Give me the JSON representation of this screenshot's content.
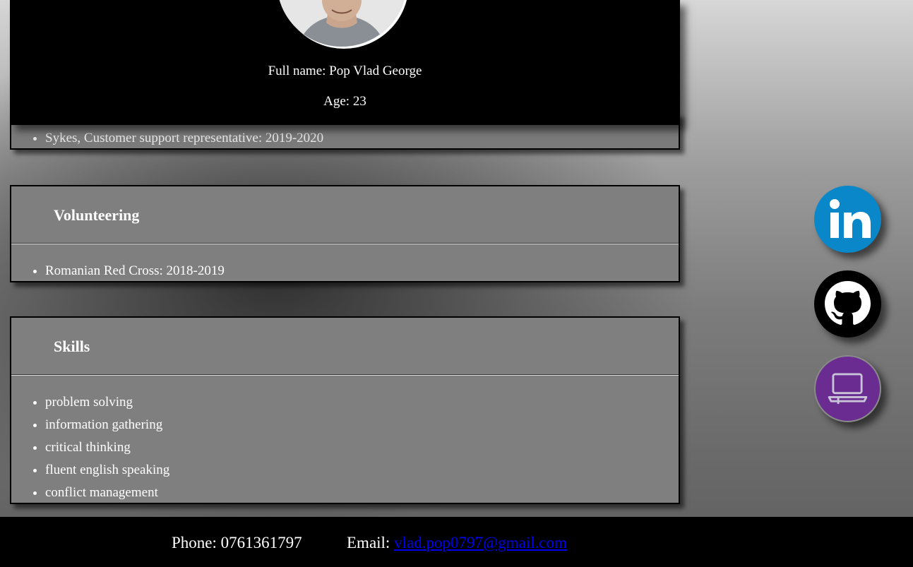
{
  "profile": {
    "fullname": "Full name: Pop Vlad George",
    "age": "Age: 23"
  },
  "work": {
    "items": [
      "Sykes, Customer support representative: 2019-2020"
    ]
  },
  "volunteering": {
    "title": "Volunteering",
    "items": [
      "Romanian Red Cross: 2018-2019"
    ]
  },
  "skills": {
    "title": "Skills",
    "items": [
      "problem solving",
      "information gathering",
      "critical thinking",
      "fluent english speaking",
      "conflict management"
    ]
  },
  "social": [
    {
      "icon": "linkedin-icon",
      "color": "#0a87c8"
    },
    {
      "icon": "github-icon",
      "color": "#000000"
    },
    {
      "icon": "laptop-icon",
      "color": "#6a2c91"
    }
  ],
  "footer": {
    "phone": "Phone: 0761361797",
    "email_label": "Email:",
    "email": "vlad.pop0797@gmail.com"
  }
}
